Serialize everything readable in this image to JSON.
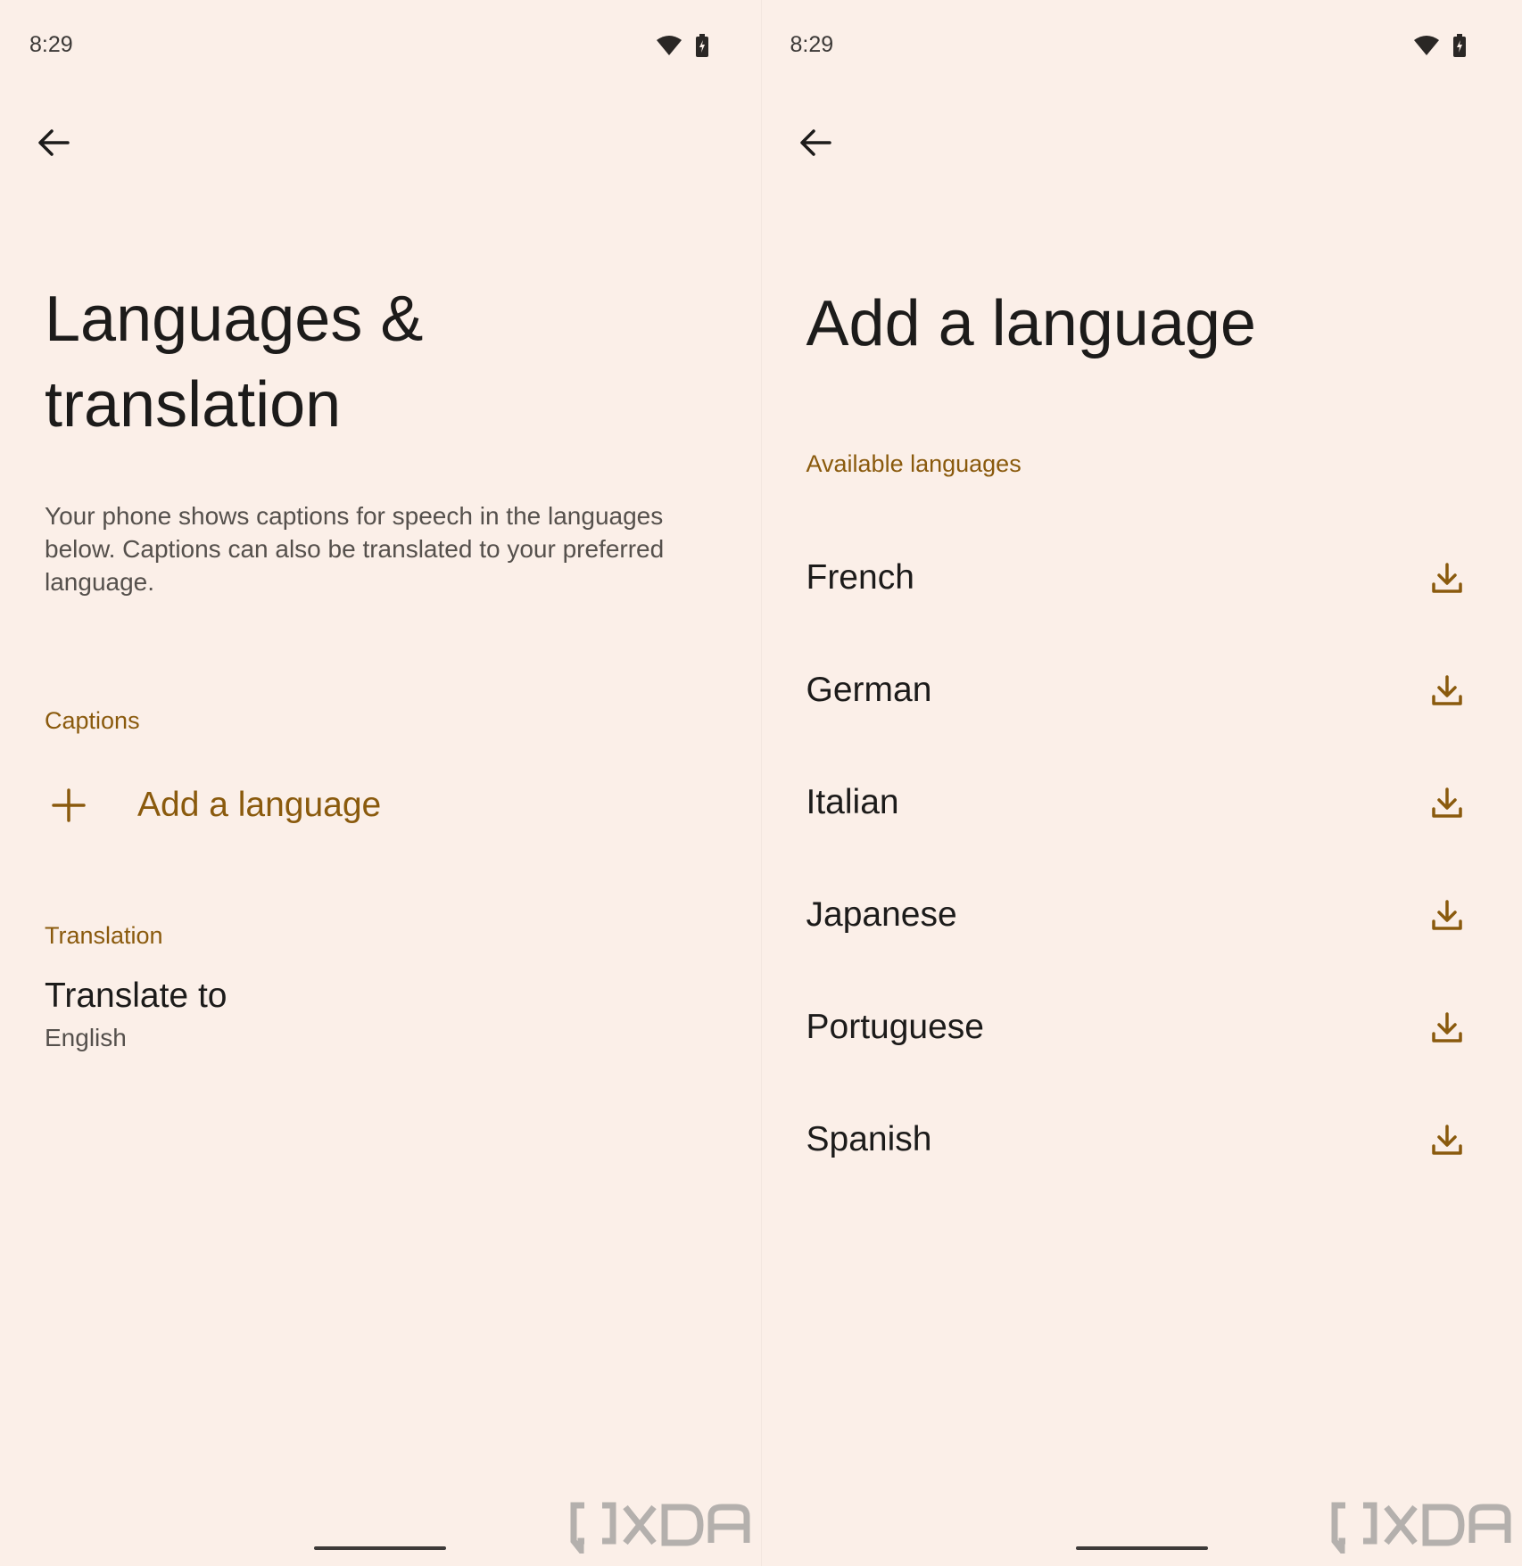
{
  "colors": {
    "background": "#fbefe8",
    "accent": "#8a5a0d",
    "text_primary": "#1c1b1a",
    "text_secondary": "#55504c"
  },
  "left_screen": {
    "status": {
      "time": "8:29",
      "icons": [
        "wifi-icon",
        "battery-icon"
      ]
    },
    "back_icon": "arrow-left-icon",
    "title": "Languages & translation",
    "description": "Your phone shows captions for speech in the languages below. Captions can also be translated to your preferred language.",
    "captions_section": {
      "header": "Captions",
      "add_language": {
        "icon": "plus-icon",
        "label": "Add a language"
      }
    },
    "translation_section": {
      "header": "Translation",
      "translate_to": {
        "title": "Translate to",
        "value": "English"
      }
    },
    "watermark": "XDA"
  },
  "right_screen": {
    "status": {
      "time": "8:29",
      "icons": [
        "wifi-icon",
        "battery-icon"
      ]
    },
    "back_icon": "arrow-left-icon",
    "title": "Add a language",
    "section_header": "Available languages",
    "languages": [
      {
        "name": "French",
        "icon": "download-icon"
      },
      {
        "name": "German",
        "icon": "download-icon"
      },
      {
        "name": "Italian",
        "icon": "download-icon"
      },
      {
        "name": "Japanese",
        "icon": "download-icon"
      },
      {
        "name": "Portuguese",
        "icon": "download-icon"
      },
      {
        "name": "Spanish",
        "icon": "download-icon"
      }
    ],
    "watermark": "XDA"
  }
}
